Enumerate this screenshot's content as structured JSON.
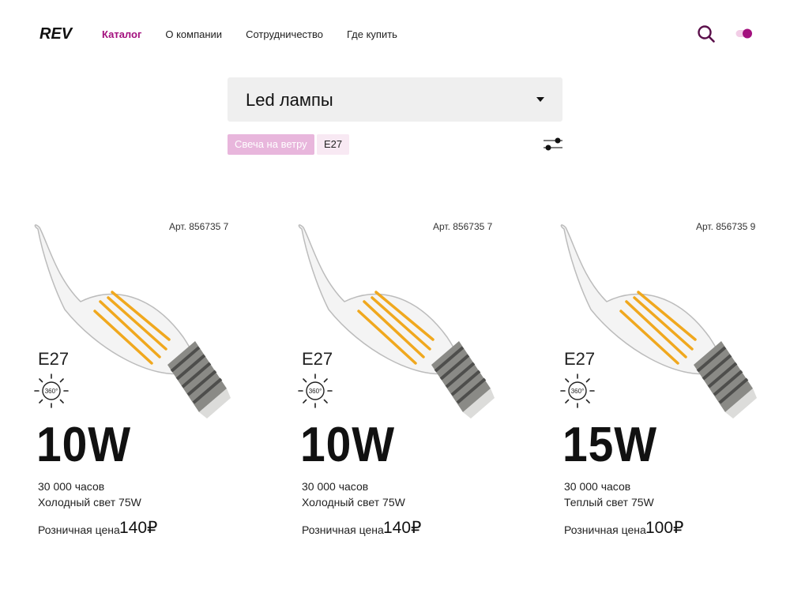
{
  "header": {
    "logo_text": "REV",
    "nav": [
      {
        "label": "Каталог",
        "active": true
      },
      {
        "label": "О компании",
        "active": false
      },
      {
        "label": "Сотрудничество",
        "active": false
      },
      {
        "label": "Где купить",
        "active": false
      }
    ],
    "icons": {
      "search": "search-icon",
      "toggle": "toggle-icon"
    }
  },
  "category": {
    "selected": "Led лампы"
  },
  "filters": {
    "chips": [
      "Свеча на ветру",
      "E27"
    ],
    "settings_icon": "sliders-icon"
  },
  "colors": {
    "accent": "#a3107e",
    "chip_active_bg": "#e8b6dc",
    "chip_bg": "#f8e9f3",
    "select_bg": "#efefef"
  },
  "products": [
    {
      "article": "Арт. 856735 7",
      "socket": "E27",
      "angle": "360°",
      "power": "10W",
      "hours": "30 000 часов",
      "light": "Холодный свет 75W",
      "price_label": "Розничная цена",
      "price": "140₽"
    },
    {
      "article": "Арт. 856735 7",
      "socket": "E27",
      "angle": "360°",
      "power": "10W",
      "hours": "30 000 часов",
      "light": "Холодный свет 75W",
      "price_label": "Розничная цена",
      "price": "140₽"
    },
    {
      "article": "Арт. 856735 9",
      "socket": "E27",
      "angle": "360°",
      "power": "15W",
      "hours": "30 000 часов",
      "light": "Теплый свет 75W",
      "price_label": "Розничная цена",
      "price": "100₽"
    }
  ]
}
